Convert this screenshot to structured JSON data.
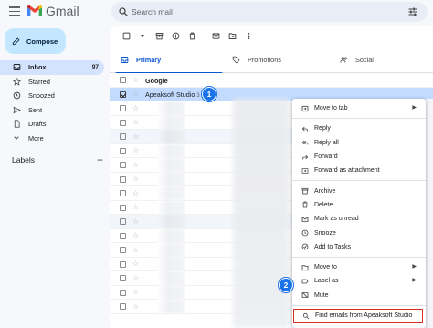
{
  "app": {
    "name": "Gmail"
  },
  "search": {
    "placeholder": "Search mail"
  },
  "compose": {
    "label": "Compose"
  },
  "sidebar": {
    "items": [
      {
        "label": "Inbox",
        "count": "97",
        "icon": "inbox-icon"
      },
      {
        "label": "Starred",
        "icon": "star-icon"
      },
      {
        "label": "Snoozed",
        "icon": "clock-icon"
      },
      {
        "label": "Sent",
        "icon": "send-icon"
      },
      {
        "label": "Drafts",
        "icon": "draft-icon"
      },
      {
        "label": "More",
        "icon": "chevron-down-icon"
      }
    ],
    "labels_title": "Labels",
    "labels_add": "+"
  },
  "tabs": [
    {
      "label": "Primary",
      "icon": "inbox-icon",
      "active": true
    },
    {
      "label": "Promotions",
      "icon": "tag-icon"
    },
    {
      "label": "Social",
      "icon": "people-icon"
    }
  ],
  "emails": [
    {
      "sender": "Google",
      "count": "",
      "unread": true
    },
    {
      "sender": "Apeaksoft Studio",
      "count": "3",
      "selected": true
    }
  ],
  "callouts": [
    "1",
    "2"
  ],
  "context_menu": {
    "groups": [
      [
        {
          "label": "Move to tab",
          "icon": "move-tab-icon",
          "submenu": true
        }
      ],
      [
        {
          "label": "Reply",
          "icon": "reply-icon"
        },
        {
          "label": "Reply all",
          "icon": "reply-all-icon"
        },
        {
          "label": "Forward",
          "icon": "forward-icon"
        },
        {
          "label": "Forward as attachment",
          "icon": "attachment-icon"
        }
      ],
      [
        {
          "label": "Archive",
          "icon": "archive-icon"
        },
        {
          "label": "Delete",
          "icon": "trash-icon"
        },
        {
          "label": "Mark as unread",
          "icon": "mail-icon"
        },
        {
          "label": "Snooze",
          "icon": "clock-icon"
        },
        {
          "label": "Add to Tasks",
          "icon": "task-icon"
        }
      ],
      [
        {
          "label": "Move to",
          "icon": "folder-move-icon",
          "submenu": true
        },
        {
          "label": "Label as",
          "icon": "label-icon",
          "submenu": true
        },
        {
          "label": "Mute",
          "icon": "mute-icon"
        }
      ],
      [
        {
          "label": "Find emails from Apeaksoft Studio",
          "icon": "search-icon",
          "highlight": true
        }
      ]
    ]
  },
  "colors": {
    "accent": "#0b57d0",
    "compose_bg": "#c2e7ff",
    "selected_row": "#c2dbff",
    "callout": "#1a73e8",
    "highlight_border": "#d93025"
  }
}
